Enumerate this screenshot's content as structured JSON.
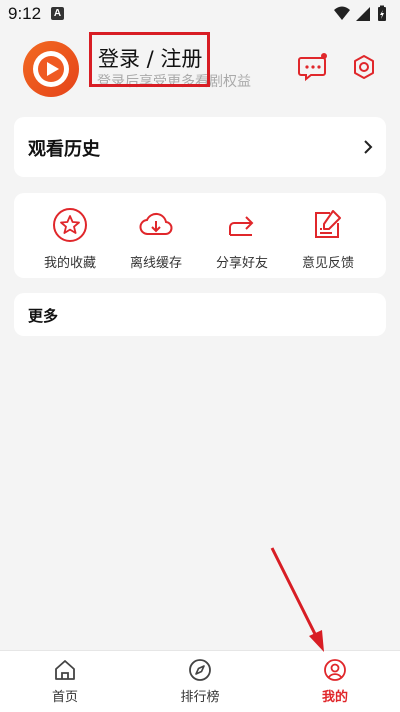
{
  "status": {
    "time": "9:12",
    "notif_badge": "A"
  },
  "header": {
    "login_title": "登录 / 注册",
    "login_subtitle": "登录后享受更多看剧权益",
    "message_icon": "message-icon",
    "settings_icon": "settings-icon"
  },
  "history": {
    "title": "观看历史"
  },
  "actions": [
    {
      "label": "我的收藏",
      "icon": "star-icon"
    },
    {
      "label": "离线缓存",
      "icon": "cloud-download-icon"
    },
    {
      "label": "分享好友",
      "icon": "share-icon"
    },
    {
      "label": "意见反馈",
      "icon": "feedback-icon"
    }
  ],
  "more": {
    "title": "更多"
  },
  "tabs": [
    {
      "label": "首页",
      "icon": "home-icon",
      "active": false
    },
    {
      "label": "排行榜",
      "icon": "compass-icon",
      "active": false
    },
    {
      "label": "我的",
      "icon": "profile-icon",
      "active": true
    }
  ],
  "colors": {
    "accent": "#e0272b",
    "brand_orange": "#f26a21",
    "highlight_box": "#d81d24"
  }
}
